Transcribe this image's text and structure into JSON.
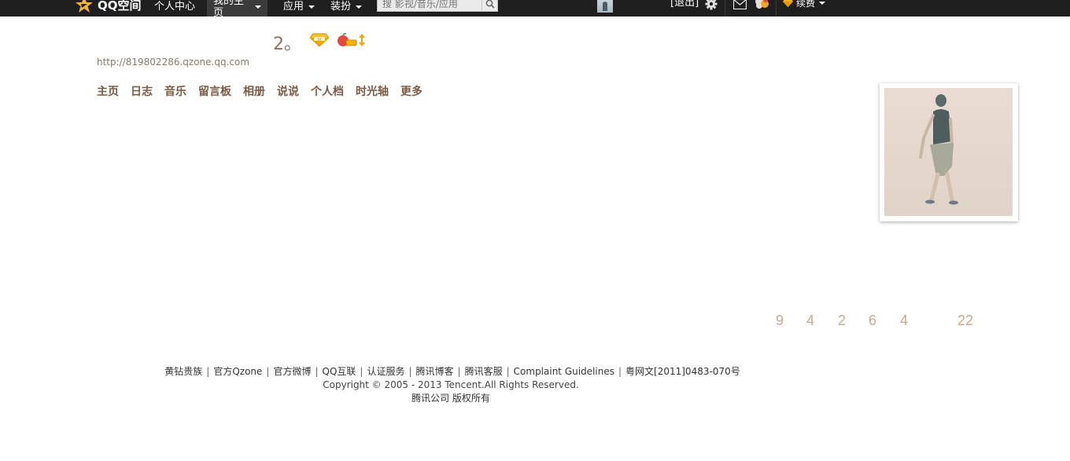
{
  "topbar": {
    "logo_text": "QQ空间",
    "nav": [
      {
        "label": "个人中心",
        "has_caret": false,
        "active": false
      },
      {
        "label": "我的主页",
        "has_caret": true,
        "active": true
      },
      {
        "label": "应用",
        "has_caret": true,
        "active": false
      },
      {
        "label": "装扮",
        "has_caret": true,
        "active": false
      }
    ],
    "search_placeholder": "搜 影视/音乐/应用",
    "logout_label": "[退出]",
    "renew_label": "续费"
  },
  "header": {
    "title": "2。",
    "url": "http://819802286.qzone.qq.com",
    "menu": [
      "主页",
      "日志",
      "音乐",
      "留言板",
      "相册",
      "说说",
      "个人档",
      "时光轴",
      "更多"
    ]
  },
  "stats": [
    "9",
    "4",
    "2",
    "6",
    "4",
    "22"
  ],
  "footer": {
    "links": [
      "黄钻贵族",
      "官方Qzone",
      "官方微博",
      "QQ互联",
      "认证服务",
      "腾讯博客",
      "腾讯客服",
      "Complaint Guidelines",
      "粤网文[2011]0483-070号"
    ],
    "copyright": "Copyright © 2005 - 2013 Tencent.All Rights Reserved.",
    "rights": "腾讯公司 版权所有"
  },
  "colors": {
    "topbar_bg": "#1f1f1f",
    "menu_text": "#7a5a44",
    "stats_text": "#c7ab8e",
    "diamond": "#f5b400"
  }
}
